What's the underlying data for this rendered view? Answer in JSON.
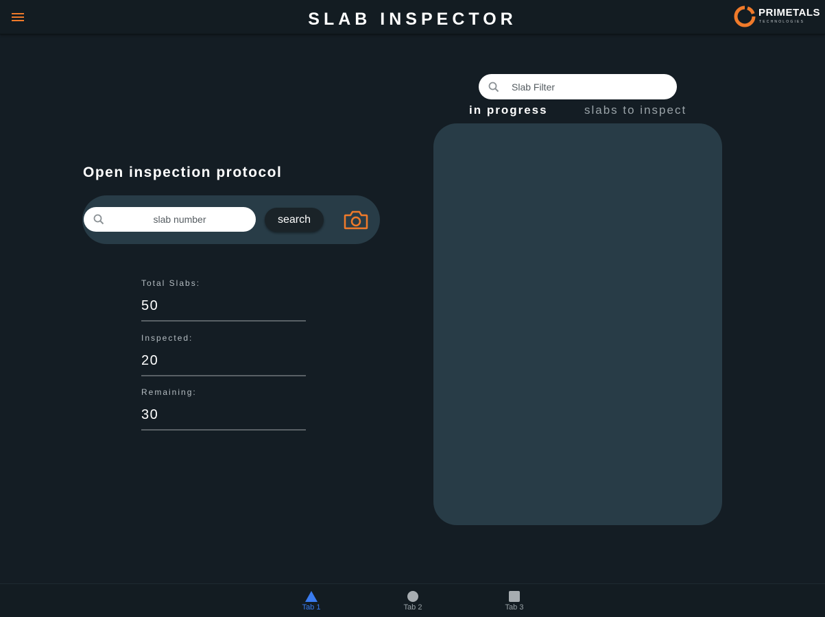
{
  "header": {
    "title": "SLAB INSPECTOR",
    "menu_icon": "hamburger-menu-icon",
    "logo": {
      "name": "PRIMETALS",
      "subtitle": "TECHNOLOGIES",
      "accent_color": "#f07a2a"
    }
  },
  "inspection": {
    "title": "Open inspection protocol",
    "slab_input_placeholder": "slab number",
    "search_button_label": "search",
    "camera_icon": "camera-icon"
  },
  "stats": [
    {
      "label": "Total Slabs:",
      "value": "50"
    },
    {
      "label": "Inspected:",
      "value": "20"
    },
    {
      "label": "Remaining:",
      "value": "30"
    }
  ],
  "slab_list": {
    "filter_placeholder": "Slab Filter",
    "tabs": [
      {
        "label": "in progress",
        "active": true
      },
      {
        "label": "slabs to inspect",
        "active": false
      }
    ]
  },
  "tabbar": {
    "tabs": [
      {
        "label": "Tab 1",
        "icon": "triangle-icon",
        "selected": true
      },
      {
        "label": "Tab 2",
        "icon": "circle-icon",
        "selected": false
      },
      {
        "label": "Tab 3",
        "icon": "square-icon",
        "selected": false
      }
    ]
  },
  "colors": {
    "background": "#141d24",
    "panel": "#283c47",
    "accent_orange": "#f07a2a",
    "tab_active_blue": "#3a7cf0"
  }
}
